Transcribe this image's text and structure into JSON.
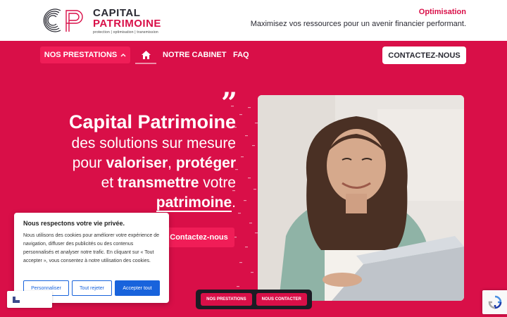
{
  "header": {
    "logo_name": "CAPITAL",
    "logo_name2": "PATRIMOINE",
    "logo_tagline": "protection | optimisation | transmission",
    "top_title": "Optimisation",
    "top_subtitle": "Maximisez vos ressources pour un avenir financier performant."
  },
  "nav": {
    "prestations_label": "NOS PRESTATIONS",
    "cabinet_label": "NOTRE CABINET",
    "faq_label": "FAQ",
    "contact_label": "CONTACTEZ-NOUS"
  },
  "hero": {
    "title": "Capital Patrimoine",
    "line1": "des solutions sur mesure",
    "line2_prefix": "pour ",
    "line2_bold1": "valoriser",
    "line2_sep": ", ",
    "line2_bold2": "protéger",
    "line3_prefix": "et ",
    "line3_bold": "transmettre",
    "line3_suffix": " votre",
    "line4_bold": "patrimoine",
    "line4_suffix": ".",
    "cta_label": "Contactez-nous"
  },
  "cookie": {
    "title": "Nous respectons votre vie privée.",
    "text": "Nous utilisons des cookies pour améliorer votre expérience de navigation, diffuser des publicités ou des contenus personnalisés et analyser notre trafic. En cliquant sur « Tout accepter », vous consentez à notre utilisation des cookies.",
    "customize_label": "Personnaliser",
    "reject_label": "Tout rejeter",
    "accept_label": "Accepter tout"
  },
  "floating_bar": {
    "prestations_label": "NOS PRESTATIONS",
    "contact_label": "NOUS CONTACTER"
  },
  "colors": {
    "brand": "#d90f48",
    "brand_light": "#f01d57",
    "dark": "#2a2a33",
    "cookie_blue": "#1863dc"
  }
}
